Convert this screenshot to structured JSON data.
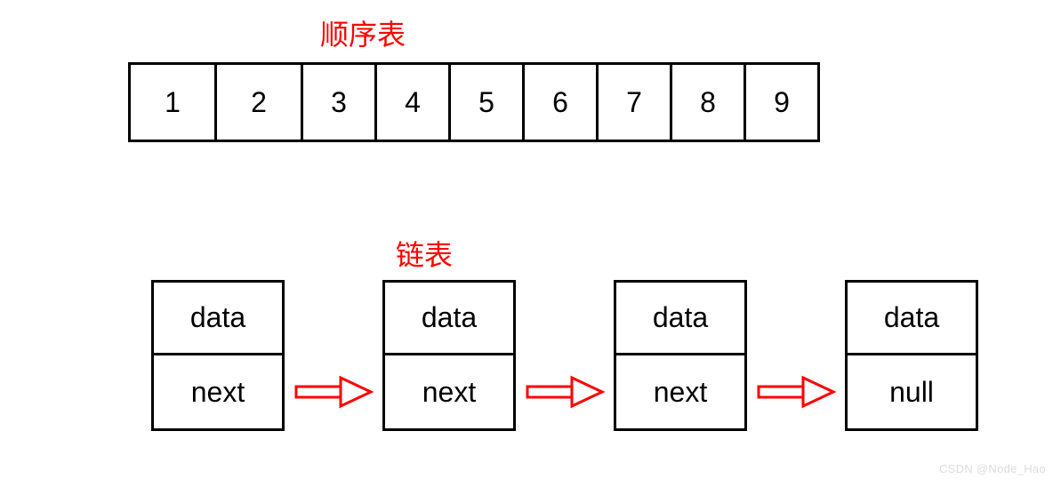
{
  "sequential": {
    "title": "顺序表",
    "cells": [
      "1",
      "2",
      "3",
      "4",
      "5",
      "6",
      "7",
      "8",
      "9"
    ]
  },
  "linked": {
    "title": "链表",
    "node_top_label": "data",
    "node_bot_label": "next",
    "terminal_label": "null",
    "arrow_color": "#ff0000",
    "nodes_count": 4
  },
  "watermark": "CSDN @Node_Hao"
}
